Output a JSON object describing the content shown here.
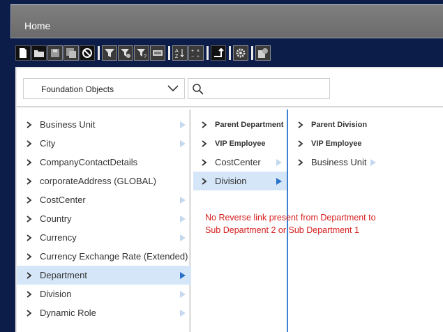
{
  "header": {
    "title": "Home"
  },
  "toolbar": {
    "buttons": [
      "new-icon",
      "open-icon",
      "save-icon",
      "save-all-icon",
      "cancel-icon",
      "filter-icon",
      "filter-settings-icon",
      "filter-query-icon",
      "rename-icon",
      "sort-icon",
      "calculator-icon",
      "flow-icon",
      "gear-icon",
      "report-icon"
    ]
  },
  "topbar": {
    "select_value": "Foundation Objects",
    "search_placeholder": ""
  },
  "col1": {
    "items": [
      {
        "label": "Business Unit"
      },
      {
        "label": "City"
      },
      {
        "label": "CompanyContactDetails"
      },
      {
        "label": "corporateAddress (GLOBAL)"
      },
      {
        "label": "CostCenter"
      },
      {
        "label": "Country"
      },
      {
        "label": "Currency"
      },
      {
        "label": "Currency Exchange Rate (Extended)"
      },
      {
        "label": "Department"
      },
      {
        "label": "Division"
      },
      {
        "label": "Dynamic Role"
      }
    ],
    "selected": "Department"
  },
  "col2": {
    "items": [
      {
        "label": "Parent Department"
      },
      {
        "label": "VIP Employee"
      },
      {
        "label": "CostCenter"
      },
      {
        "label": "Division"
      }
    ],
    "selected": "Division"
  },
  "col3": {
    "items": [
      {
        "label": "Parent Division"
      },
      {
        "label": "VIP Employee"
      },
      {
        "label": "Business Unit"
      }
    ]
  },
  "annotation": {
    "line1": "No Reverse link present from Department to",
    "line2": "Sub Department 2 or Sub Department 1"
  },
  "colors": {
    "accent_line": "#3f7fd0",
    "selected_row": "#d5e6f8",
    "annotation_text": "#d62020"
  }
}
